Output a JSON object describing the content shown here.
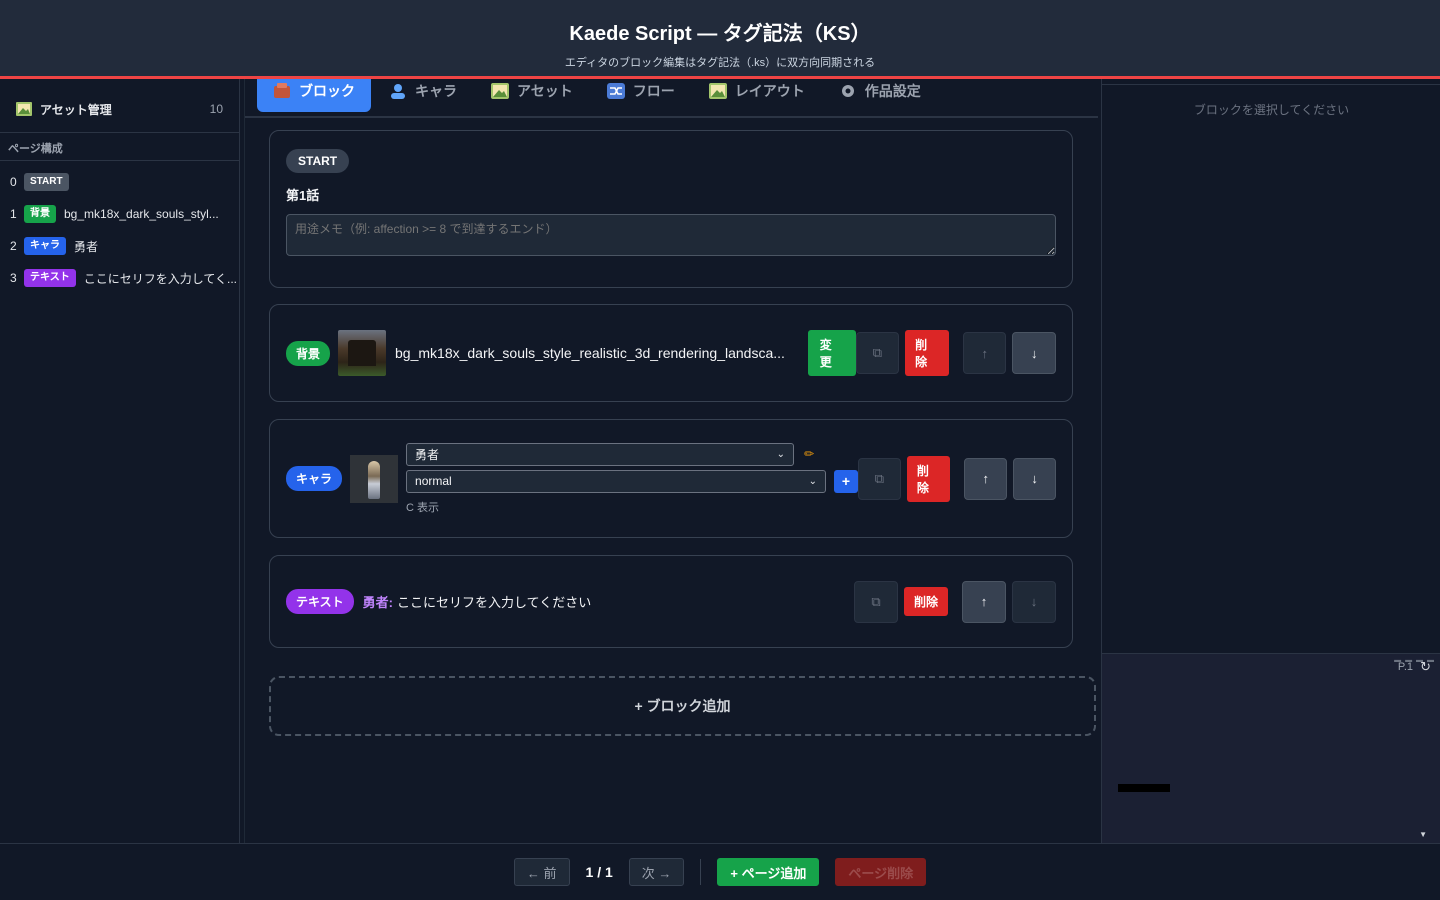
{
  "header": {
    "title": "Kaede Script — タグ記法（KS）",
    "subtitle": "エディタのブロック編集はタグ記法（.ks）に双方向同期される"
  },
  "sidebar": {
    "nav": [
      {
        "label": "アセット管理",
        "count": "10"
      }
    ],
    "section_title": "ページ構成",
    "pages": [
      {
        "index": "0",
        "tag": "START",
        "label": ""
      },
      {
        "index": "1",
        "tag": "背景",
        "label": "bg_mk18x_dark_souls_styl..."
      },
      {
        "index": "2",
        "tag": "キャラ",
        "label": "勇者"
      },
      {
        "index": "3",
        "tag": "テキスト",
        "label": "ここにセリフを入力してく..."
      }
    ]
  },
  "tabs": [
    {
      "label": "ブロック",
      "active": true
    },
    {
      "label": "キャラ"
    },
    {
      "label": "アセット"
    },
    {
      "label": "フロー"
    },
    {
      "label": "レイアウト"
    },
    {
      "label": "作品設定"
    }
  ],
  "start_block": {
    "badge": "START",
    "title": "第1話",
    "memo_placeholder": "用途メモ（例: affection >= 8 で到達するエンド）"
  },
  "bg_block": {
    "tag": "背景",
    "filename": "bg_mk18x_dark_souls_style_realistic_3d_rendering_landsca...",
    "change_label": "変更",
    "delete_label": "削除"
  },
  "chara_block": {
    "tag": "キャラ",
    "name_value": "勇者",
    "expression_value": "normal",
    "sub_label": "C 表示",
    "add_label": "+",
    "delete_label": "削除"
  },
  "text_block": {
    "tag": "テキスト",
    "speaker": "勇者:",
    "line": "ここにセリフを入力してください",
    "delete_label": "削除"
  },
  "add_block_label": "+ ブロック追加",
  "inspector": {
    "hint": "ブロックを選択してください"
  },
  "preview": {
    "page": "P.1"
  },
  "footer": {
    "prev": "← 前",
    "pager": "1 / 1",
    "next": "次 →",
    "add_page": "+ ページ追加",
    "delete_page": "ページ削除"
  },
  "colors": {
    "accent": "#3b82f6",
    "header_border": "#ef4444",
    "bg_tag": "#16a34a",
    "chara_tag": "#2563eb",
    "text_tag": "#9333ea",
    "delete": "#dc2626"
  },
  "icons": {
    "tabs": [
      "block-icon",
      "user-icon",
      "image-icon",
      "shuffle-icon",
      "layout-icon",
      "gear-icon"
    ]
  }
}
